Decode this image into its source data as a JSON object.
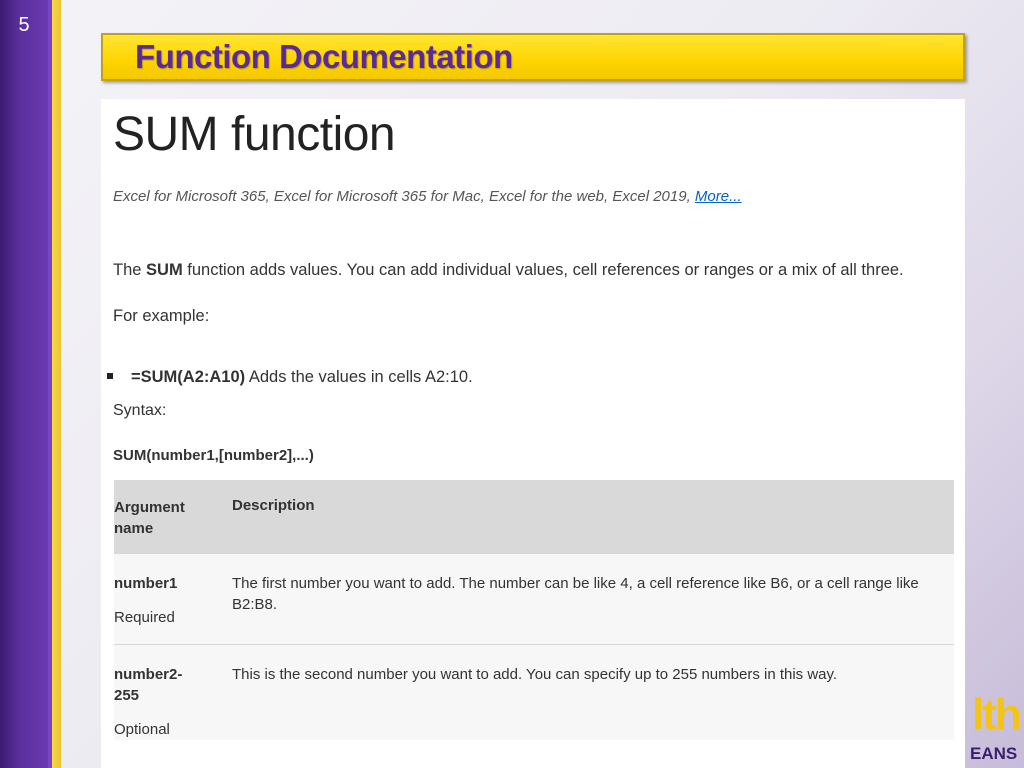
{
  "slide": {
    "number": "5",
    "title": "Function Documentation"
  },
  "doc": {
    "heading": "SUM function",
    "applies_to": "Excel for Microsoft 365, Excel for Microsoft 365 for Mac, Excel for the web, Excel 2019,",
    "more_link": "More...",
    "intro_pre": "The ",
    "intro_bold": "SUM",
    "intro_post": " function adds values. You can add individual values, cell references or ranges or a mix of all three.",
    "for_example": "For example:",
    "example_formula": "=SUM(A2:A10)",
    "example_desc": "Adds the values in cells A2:10.",
    "syntax_label": "Syntax:",
    "syntax_formula": "SUM(number1,[number2],...)"
  },
  "table": {
    "headers": [
      "Argument name",
      "Description"
    ],
    "rows": [
      {
        "name": "number1",
        "req": "Required",
        "desc": "The first number you want to add. The number can be like 4, a cell reference like B6, or a cell range like B2:B8."
      },
      {
        "name": "number2-255",
        "req": "Optional",
        "desc": "This is the second number you want to add. You can specify up to 255 numbers in this way."
      }
    ]
  },
  "logo": {
    "word": "lth",
    "sub": "EANS"
  },
  "colors": {
    "accent_purple": "#5b2a9a",
    "banner_yellow": "#ffd400",
    "link_blue": "#0563c1"
  }
}
